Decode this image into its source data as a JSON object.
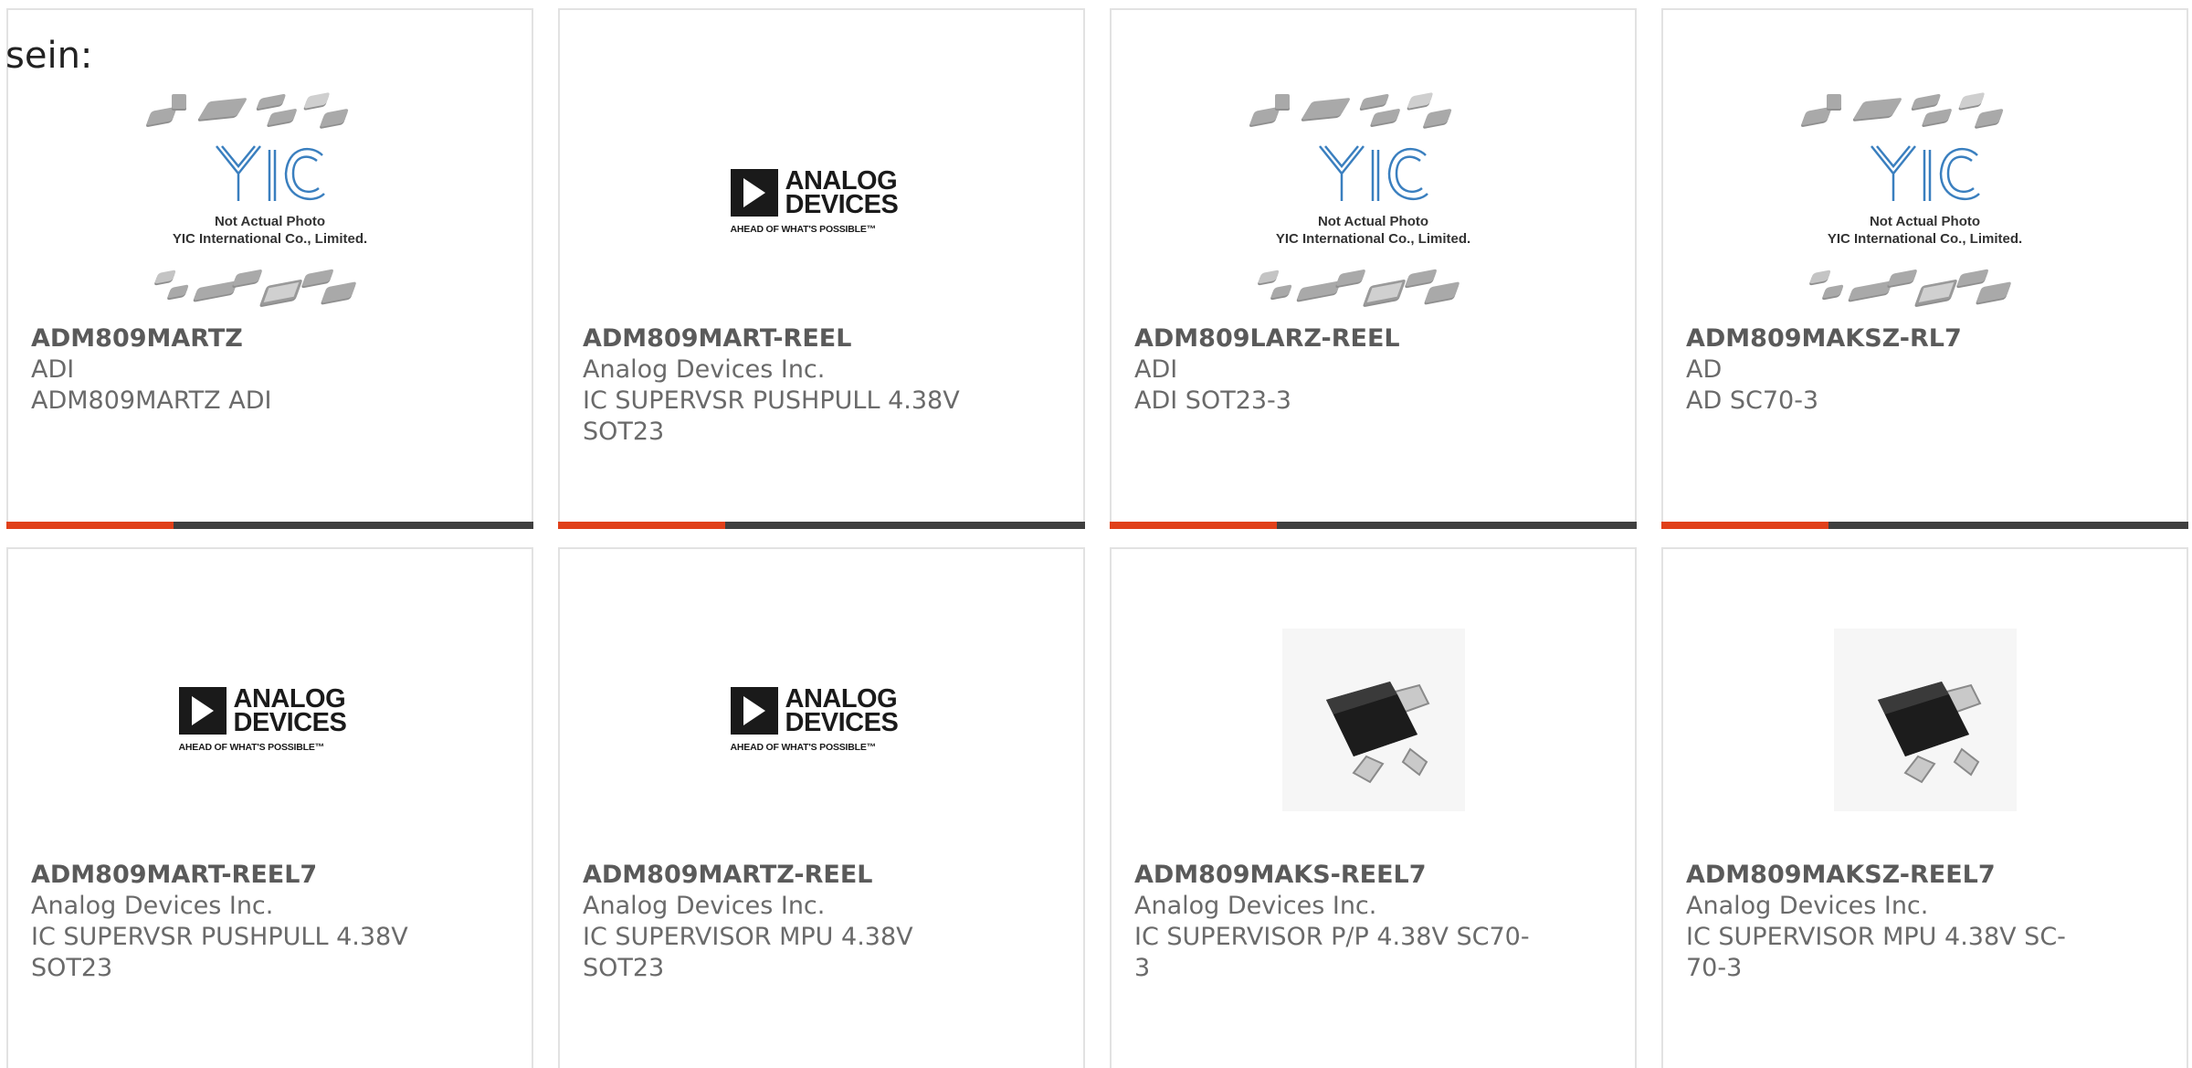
{
  "heading": "sein:",
  "placeholder": {
    "line1": "Not Actual Photo",
    "line2": "YIC International Co., Limited.",
    "logo_text": "YIC"
  },
  "analog_logo": {
    "name_line1": "ANALOG",
    "name_line2": "DEVICES",
    "tagline": "AHEAD OF WHAT'S POSSIBLE™"
  },
  "accent_color": "#e0401a",
  "bar_color": "#3f3f3f",
  "products": [
    {
      "part": "ADM809MARTZ",
      "manufacturer": "ADI",
      "description": "ADM809MARTZ ADI",
      "image": "yic-placeholder"
    },
    {
      "part": "ADM809MART-REEL",
      "manufacturer": "Analog Devices Inc.",
      "description": "IC SUPERVSR PUSHPULL 4.38V SOT23",
      "image": "analog-devices-logo"
    },
    {
      "part": "ADM809LARZ-REEL",
      "manufacturer": "ADI",
      "description": "ADI SOT23-3",
      "image": "yic-placeholder"
    },
    {
      "part": "ADM809MAKSZ-RL7",
      "manufacturer": "AD",
      "description": "AD SC70-3",
      "image": "yic-placeholder"
    },
    {
      "part": "ADM809MART-REEL7",
      "manufacturer": "Analog Devices Inc.",
      "description": "IC SUPERVSR PUSHPULL 4.38V SOT23",
      "image": "analog-devices-logo"
    },
    {
      "part": "ADM809MARTZ-REEL",
      "manufacturer": "Analog Devices Inc.",
      "description": "IC SUPERVISOR MPU 4.38V SOT23",
      "image": "analog-devices-logo"
    },
    {
      "part": "ADM809MAKS-REEL7",
      "manufacturer": "Analog Devices Inc.",
      "description": "IC SUPERVISOR P/P 4.38V SC70-3",
      "image": "sot-component-photo"
    },
    {
      "part": "ADM809MAKSZ-REEL7",
      "manufacturer": "Analog Devices Inc.",
      "description": "IC SUPERVISOR MPU 4.38V SC-70-3",
      "image": "sot-component-photo"
    }
  ]
}
